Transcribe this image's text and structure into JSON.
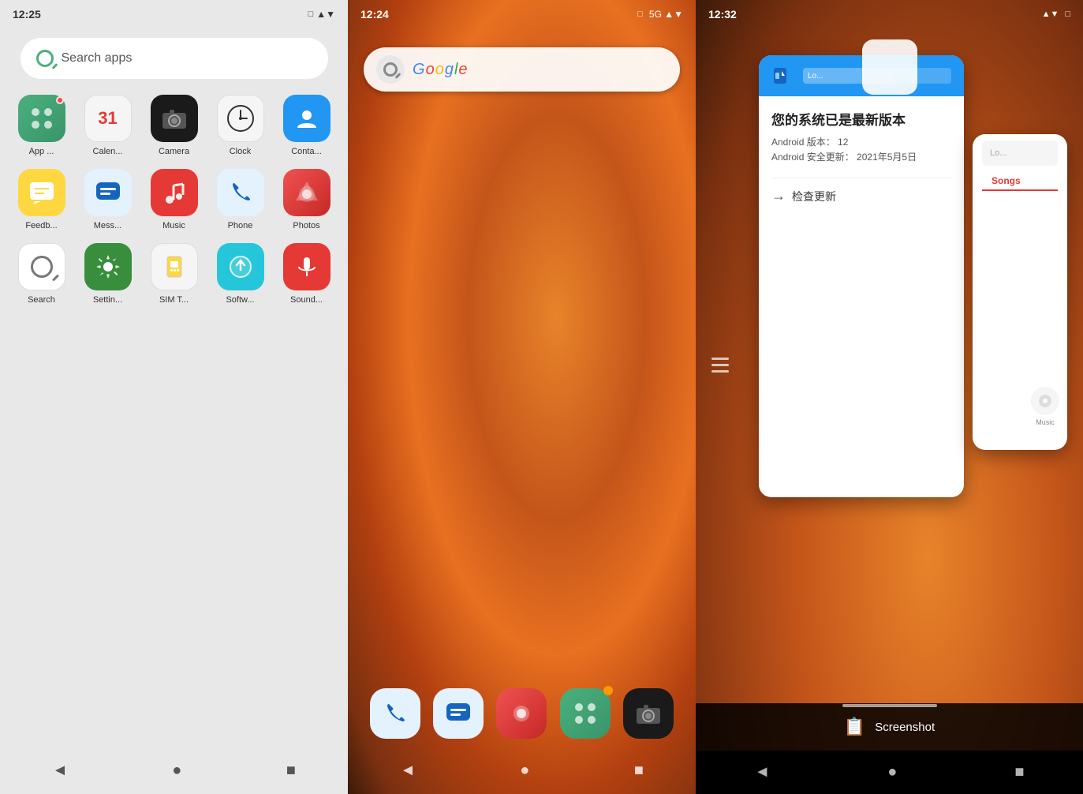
{
  "panel1": {
    "status": {
      "time": "12:25",
      "signal": "▲▼",
      "battery": "□"
    },
    "search": {
      "placeholder": "Search apps"
    },
    "apps": [
      {
        "id": "appvault",
        "label": "App ...",
        "icon": "⊞",
        "color": "ic-appvault",
        "badge": true
      },
      {
        "id": "calendar",
        "label": "Calen...",
        "icon": "31",
        "color": "ic-calendar",
        "badge": false
      },
      {
        "id": "camera",
        "label": "Camera",
        "icon": "📷",
        "color": "ic-camera",
        "badge": false
      },
      {
        "id": "clock",
        "label": "Clock",
        "icon": "🕐",
        "color": "ic-clock",
        "badge": false
      },
      {
        "id": "contacts",
        "label": "Conta...",
        "icon": "👤",
        "color": "ic-contacts",
        "badge": false
      },
      {
        "id": "feedback",
        "label": "Feedb...",
        "icon": "💬",
        "color": "ic-feedback",
        "badge": false
      },
      {
        "id": "messages",
        "label": "Mess...",
        "icon": "💬",
        "color": "ic-messages",
        "badge": false
      },
      {
        "id": "music",
        "label": "Music",
        "icon": "♫",
        "color": "ic-music",
        "badge": false
      },
      {
        "id": "phone",
        "label": "Phone",
        "icon": "📞",
        "color": "ic-phone",
        "badge": false
      },
      {
        "id": "photos",
        "label": "Photos",
        "icon": "◉",
        "color": "ic-photos",
        "badge": false
      },
      {
        "id": "search",
        "label": "Search",
        "icon": "🔍",
        "color": "ic-search-app",
        "badge": false
      },
      {
        "id": "settings",
        "label": "Settin...",
        "icon": "⚙",
        "color": "ic-settings",
        "badge": false
      },
      {
        "id": "simt",
        "label": "SIM T...",
        "icon": "⊞",
        "color": "ic-simt",
        "badge": false
      },
      {
        "id": "software",
        "label": "Softw...",
        "icon": "↑",
        "color": "ic-softw",
        "badge": false
      },
      {
        "id": "sound",
        "label": "Sound...",
        "icon": "🎵",
        "color": "ic-sound",
        "badge": false
      }
    ],
    "nav": {
      "back": "◄",
      "home": "●",
      "recents": "■"
    }
  },
  "panel2": {
    "status": {
      "time": "12:24",
      "network": "5G",
      "battery": "□"
    },
    "google": {
      "placeholder": "Google"
    },
    "dock": [
      {
        "id": "phone",
        "color": "#e3f2fd"
      },
      {
        "id": "messages",
        "color": "#e3f2fd"
      },
      {
        "id": "photos",
        "color": "#fff"
      },
      {
        "id": "appvault",
        "color": "#4caf7d",
        "badge": true
      },
      {
        "id": "camera",
        "color": "#1a1a1a"
      }
    ],
    "nav": {
      "back": "◄",
      "home": "●",
      "recents": "■"
    }
  },
  "panel3": {
    "status": {
      "time": "12:32",
      "network": "WiFi",
      "battery": "□"
    },
    "cards": {
      "settings": {
        "header_color": "#2196f3",
        "title": "您的系统已是最新版本",
        "android_version_label": "Android 版本：",
        "android_version": "12",
        "security_update_label": "Android 安全更新：",
        "security_update": "2021年5月5日",
        "check_update": "检查更新"
      },
      "music": {
        "search_placeholder": "Lo...",
        "songs_tab": "Songs"
      }
    },
    "screenshot": {
      "icon": "📋",
      "label": "Screenshot"
    },
    "nav": {
      "back": "◄",
      "home": "●",
      "recents": "■"
    }
  }
}
